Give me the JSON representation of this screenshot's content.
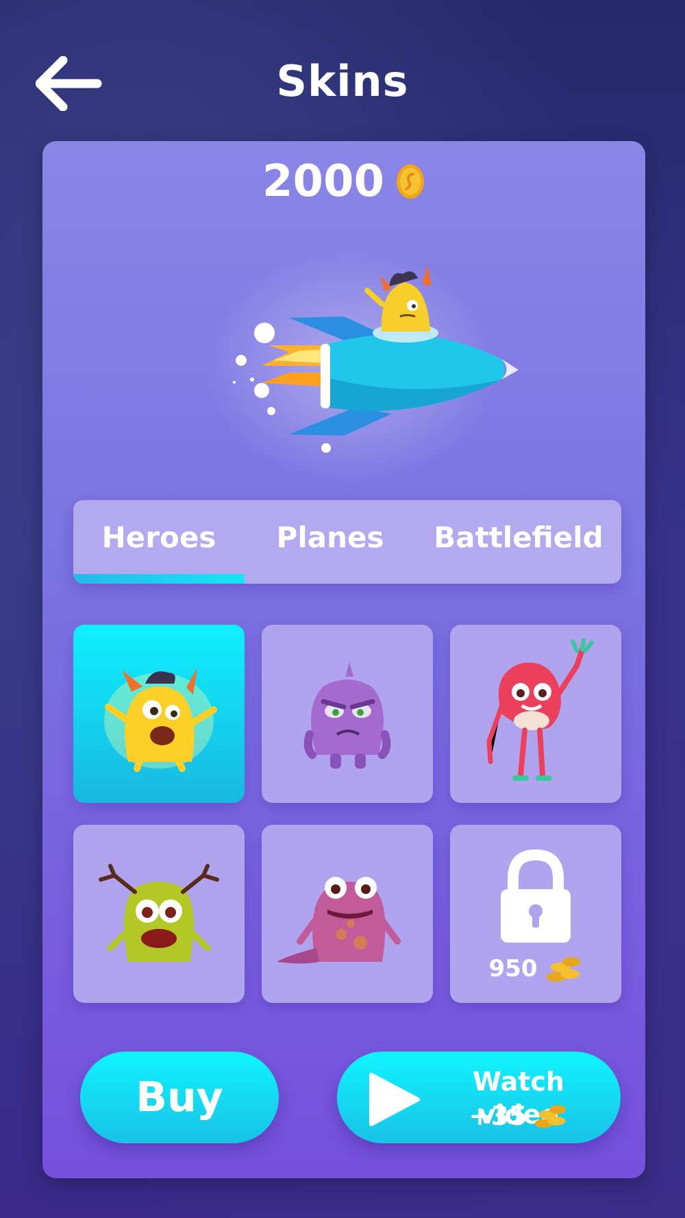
{
  "header": {
    "title": "Skins",
    "back_icon": "arrow-left-icon"
  },
  "wallet": {
    "coins": "2000",
    "icon": "coin-icon"
  },
  "tabs": [
    {
      "label": "Heroes",
      "active": true
    },
    {
      "label": "Planes",
      "active": false
    },
    {
      "label": "Battlefield",
      "active": false
    }
  ],
  "skins": [
    {
      "name": "yellow-horned-monster",
      "selected": true
    },
    {
      "name": "purple-grumpy-monster",
      "selected": false
    },
    {
      "name": "red-waving-monster",
      "selected": false
    },
    {
      "name": "green-antenna-monster",
      "selected": false
    },
    {
      "name": "purple-spotted-monster",
      "selected": false
    },
    {
      "name": "locked-skin",
      "locked": true,
      "price": "950",
      "icon": "coin-stack-icon"
    }
  ],
  "actions": {
    "buy_label": "Buy",
    "watch_video_label": "Watch video",
    "watch_video_reward": "+35",
    "play_icon": "play-icon"
  },
  "colors": {
    "accent": "#14e6f6",
    "panel": "#7b73e2",
    "tab_bg": "#b2a9ee",
    "cell_bg": "#b1a4ee"
  }
}
